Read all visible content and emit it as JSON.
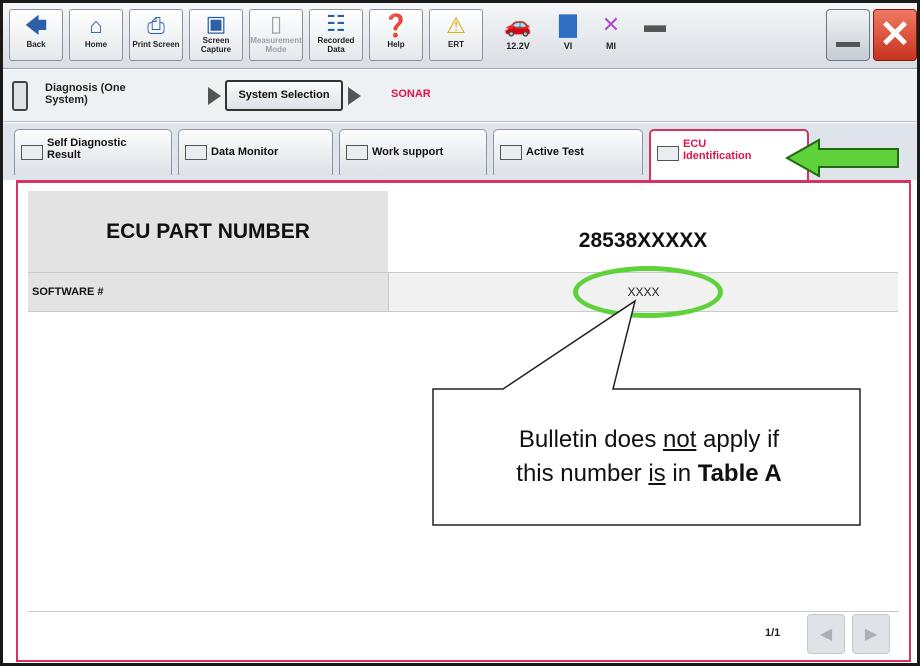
{
  "toolbar": {
    "back": "Back",
    "home": "Home",
    "print_screen": "Print Screen",
    "screen_capture": "Screen Capture",
    "measurement_mode": "Measurement Mode",
    "recorded_data": "Recorded Data",
    "help": "Help",
    "ert": "ERT",
    "voltage": "12.2V",
    "vi": "VI",
    "mi": "MI"
  },
  "breadcrumb": {
    "diagnosis": "Diagnosis (One System)",
    "system_selection": "System Selection",
    "current": "SONAR"
  },
  "tabs": [
    {
      "label": "Self Diagnostic Result"
    },
    {
      "label": "Data Monitor"
    },
    {
      "label": "Work support"
    },
    {
      "label": "Active Test"
    },
    {
      "label": "ECU Identification"
    }
  ],
  "ecu": {
    "part_number_label": "ECU PART NUMBER",
    "part_number_value": "28538XXXXX",
    "software_label": "SOFTWARE #",
    "software_value": "XXXX"
  },
  "pagination": {
    "page": "1/1"
  },
  "callout": {
    "line1_a": "Bulletin does ",
    "line1_not": "not",
    "line1_b": " apply if",
    "line2_a": "this number ",
    "line2_is": "is",
    "line2_b": " in ",
    "line2_table": "Table A"
  },
  "colors": {
    "active_tab_border": "#d63361",
    "annotation_green": "#5fd13a",
    "sonar_text": "#e0134c"
  },
  "icons": [
    "back-arrow-icon",
    "home-icon",
    "printer-icon",
    "camera-icon",
    "meter-icon",
    "recorded-data-icon",
    "help-icon",
    "warning-icon",
    "car-icon",
    "signal-icon",
    "x-icon",
    "battery-icon"
  ]
}
